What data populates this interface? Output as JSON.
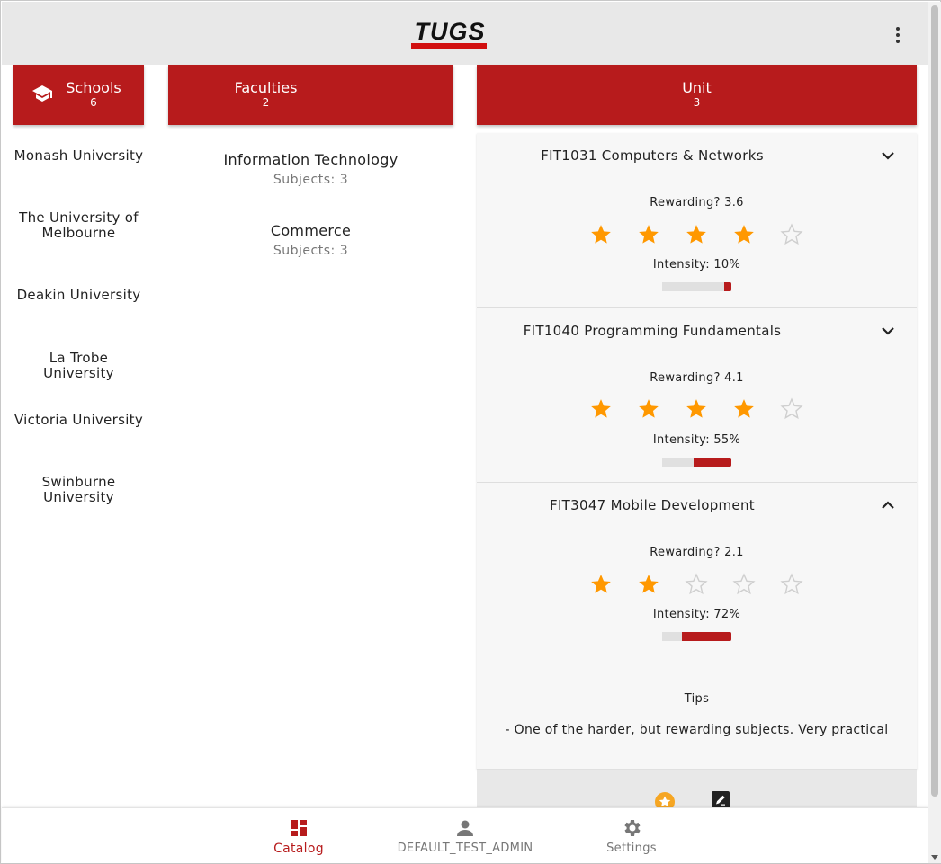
{
  "app": {
    "logo_text": "TUGS",
    "brand_color": "#b71b1c",
    "accent_star_color": "#ff9800"
  },
  "columns": {
    "schools": {
      "title": "Schools",
      "count": "6",
      "icon": "school-icon"
    },
    "faculties": {
      "title": "Faculties",
      "count": "2"
    },
    "unit": {
      "title": "Unit",
      "count": "3"
    }
  },
  "schools": [
    "Monash University",
    "The University of Melbourne",
    "Deakin University",
    "La Trobe University",
    "Victoria University",
    "Swinburne University"
  ],
  "faculties": [
    {
      "name": "Information Technology",
      "subjects": "Subjects: 3"
    },
    {
      "name": "Commerce",
      "subjects": "Subjects: 3"
    }
  ],
  "units": [
    {
      "title": "FIT1031 Computers & Networks",
      "expanded": false,
      "rewarding_label": "Rewarding? 3.6",
      "stars_filled": 4,
      "stars_total": 5,
      "intensity_label": "Intensity: 10%",
      "intensity": 0.1
    },
    {
      "title": "FIT1040 Programming Fundamentals",
      "expanded": false,
      "rewarding_label": "Rewarding? 4.1",
      "stars_filled": 4,
      "stars_total": 5,
      "intensity_label": "Intensity: 55%",
      "intensity": 0.55
    },
    {
      "title": "FIT3047 Mobile Development",
      "expanded": true,
      "rewarding_label": "Rewarding? 2.1",
      "stars_filled": 2,
      "stars_total": 5,
      "intensity_label": "Intensity: 72%",
      "intensity": 0.72,
      "tips_title": "Tips",
      "tips_text": "- One of the harder, but rewarding subjects. Very practical"
    }
  ],
  "actions": [
    {
      "icon": "rate-star-icon"
    },
    {
      "icon": "edit-review-icon"
    }
  ],
  "bottom_nav": [
    {
      "label": "Catalog",
      "icon": "catalog-icon",
      "active": true
    },
    {
      "label": "DEFAULT_TEST_ADMIN",
      "icon": "person-icon",
      "active": false
    },
    {
      "label": "Settings",
      "icon": "gear-icon",
      "active": false
    }
  ]
}
